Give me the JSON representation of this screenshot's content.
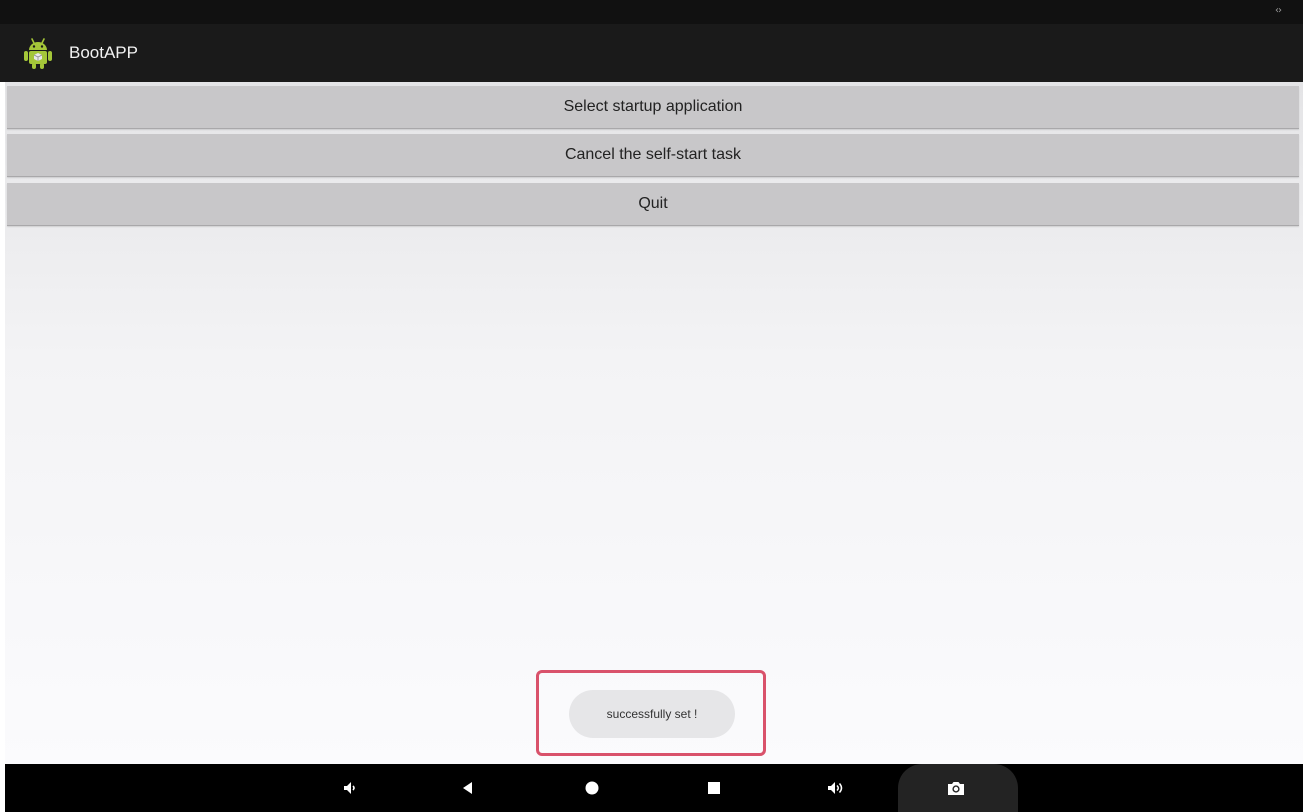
{
  "app": {
    "title": "BootAPP"
  },
  "buttons": {
    "select_startup": "Select startup application",
    "cancel_selfstart": "Cancel the self-start task",
    "quit": "Quit"
  },
  "toast": {
    "message": "successfully set !"
  },
  "status_bar": {
    "indicator": "‹›"
  },
  "nav_bar": {
    "icons": [
      "volume-down-icon",
      "back-icon",
      "home-icon",
      "recents-icon",
      "volume-up-icon",
      "screenshot-icon"
    ]
  },
  "colors": {
    "android_green": "#a4c639",
    "highlight_border": "#d9526b",
    "action_bar": "#1a1a1a",
    "button_bg": "#c8c7c9"
  }
}
